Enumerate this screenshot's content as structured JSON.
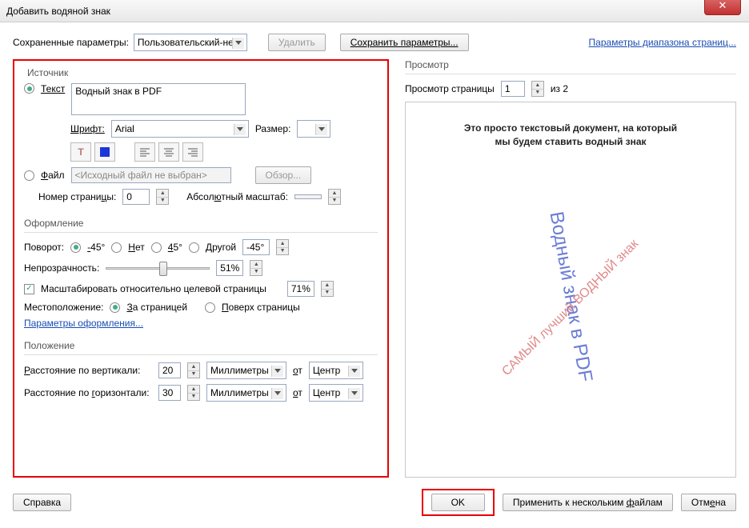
{
  "title": "Добавить водяной знак",
  "toprow": {
    "saved_label": "Сохраненные параметры:",
    "saved_value": "Пользовательский-не",
    "delete_btn": "Удалить",
    "save_btn": "Сохранить параметры...",
    "range_link": "Параметры диапазона страниц..."
  },
  "source": {
    "legend": "Источник",
    "text_radio": "Текст",
    "text_value": "Водный знак в PDF",
    "font_label": "Шрифт:",
    "font_value": "Arial",
    "size_label": "Размер:",
    "size_value": "",
    "file_radio": "Файл",
    "file_value": "<Исходный файл не выбран>",
    "browse_btn": "Обзор...",
    "page_label": "Номер страницы:",
    "page_value": "0",
    "abs_scale_label": "Абсолютный масштаб:",
    "abs_scale_value": ""
  },
  "appearance": {
    "legend": "Оформление",
    "rotation_label": "Поворот:",
    "rot_neg45": "-45°",
    "rot_none": "Нет",
    "rot_45": "45°",
    "rot_other": "Другой",
    "rot_value": "-45°",
    "opacity_label": "Непрозрачность:",
    "opacity_value": "51%",
    "scale_check": "Масштабировать относительно целевой страницы",
    "scale_value": "71%",
    "location_label": "Местоположение:",
    "loc_behind": "За страницей",
    "loc_front": "Поверх страницы",
    "options_link": "Параметры оформления..."
  },
  "position": {
    "legend": "Положение",
    "vdist_label": "Расстояние по вертикали:",
    "vdist_value": "20",
    "hdist_label": "Расстояние по горизонтали:",
    "hdist_value": "30",
    "unit": "Миллиметры",
    "from_label": "от",
    "from_value": "Центр"
  },
  "preview": {
    "legend": "Просмотр",
    "page_label": "Просмотр страницы",
    "page_value": "1",
    "of_label": "из 2",
    "doc_line1": "Это просто текстовый документ, на который",
    "doc_line2": "мы будем ставить водный знак",
    "wm1": "Водный знак в PDF",
    "wm2": "САМЫЙ лучший ВОДНЫЙ знак"
  },
  "buttons": {
    "help": "Справка",
    "ok": "OK",
    "apply_multi": "Применить к нескольким файлам",
    "cancel": "Отмена"
  }
}
